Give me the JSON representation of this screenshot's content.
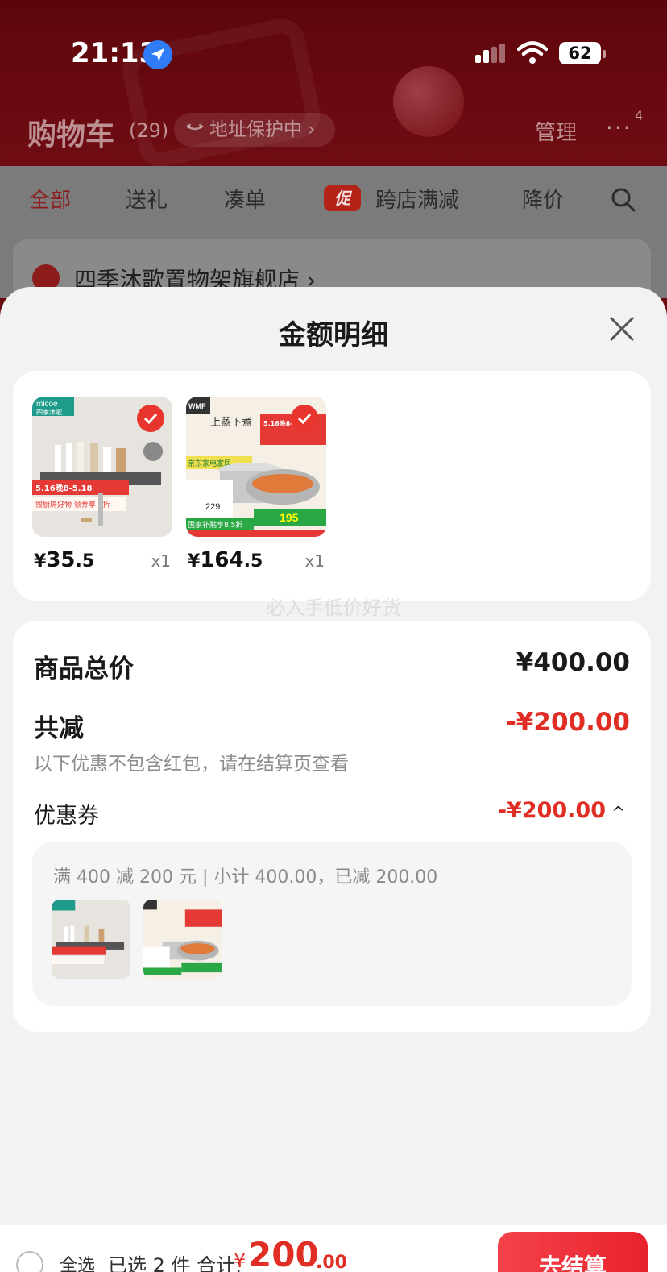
{
  "status_bar": {
    "time": "21:13",
    "battery": "62"
  },
  "header": {
    "title": "购物车",
    "count": "(29)",
    "address_pill": "地址保护中 ›",
    "manage": "管理",
    "more": "···",
    "more_badge": "4"
  },
  "tabs": [
    "全部",
    "送礼",
    "凑单",
    "跨店满减",
    "降价"
  ],
  "promo_badge": "促",
  "store": {
    "name": "四季沐歌置物架旗舰店 ›"
  },
  "sheet": {
    "title": "金额明细",
    "products": [
      {
        "price_symbol": "¥",
        "price_int": "35",
        "price_dec": ".5",
        "qty": "x1",
        "brand": "micoe",
        "brand_sub": "四季沐歌",
        "banner": "5.16晚8-5.18",
        "banner2": "搜厨房好物 领券享 5折"
      },
      {
        "price_symbol": "¥",
        "price_int": "164",
        "price_dec": ".5",
        "qty": "x1",
        "brand": "WMF",
        "headline": "上蒸下煮",
        "banner": "5.16晚8-5.18",
        "promo_text": "京东家电家居",
        "promo_price": "195",
        "subsidy": "国家补贴享8.5折",
        "old_price": "229"
      }
    ],
    "watermark": "必入手低价好货",
    "summary": {
      "total_label": "商品总价",
      "total_value": "¥400.00",
      "discount_label": "共减",
      "discount_value": "-¥200.00",
      "note": "以下优惠不包含红包，请在结算页查看",
      "coupon_label": "优惠券",
      "coupon_value": "-¥200.00",
      "coupon_toggle": "^",
      "coupon_desc": "满 400 减 200 元 | 小计 400.00，已减 200.00"
    }
  },
  "bottom_bar": {
    "select_all": "全选",
    "selected_info": "已选 2 件  合计:",
    "currency": "¥",
    "total_int": "200",
    "total_dec": ".00",
    "checkout": "去结算"
  },
  "colors": {
    "accent_red": "#e02e24",
    "header_bg": "#6a0a10"
  }
}
